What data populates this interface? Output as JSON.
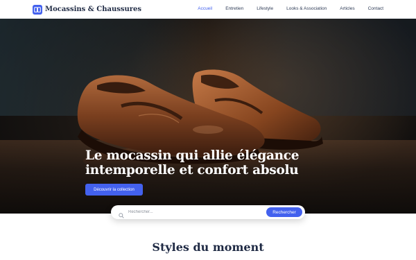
{
  "brand": {
    "name": "Mocassins & Chaussures",
    "icon": "book-icon",
    "accent": "#4361ee"
  },
  "nav": {
    "items": [
      {
        "label": "Accueil",
        "active": true
      },
      {
        "label": "Entretien",
        "active": false
      },
      {
        "label": "Lifestyle",
        "active": false
      },
      {
        "label": "Looks & Association",
        "active": false
      },
      {
        "label": "Articles",
        "active": false
      },
      {
        "label": "Contact",
        "active": false
      }
    ]
  },
  "hero": {
    "title": "Le mocassin qui allie élégance intemporelle et confort absolu",
    "cta_label": "Découvrir la collection"
  },
  "search": {
    "placeholder": "Rechercher...",
    "value": "",
    "button_label": "Rechercher",
    "icon": "search-icon"
  },
  "section": {
    "title": "Styles du moment"
  }
}
